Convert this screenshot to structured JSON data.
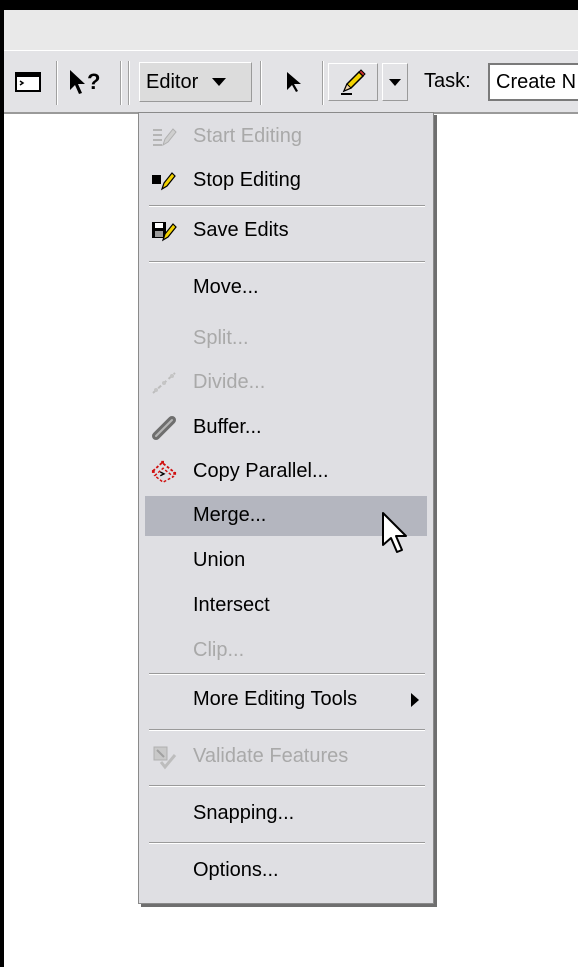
{
  "toolbar": {
    "editor_label": "Editor",
    "task_label": "Task:",
    "task_value": "Create N"
  },
  "menu": {
    "items": [
      {
        "label": "Start Editing",
        "enabled": false,
        "icon": "start-editing-icon"
      },
      {
        "label": "Stop Editing",
        "enabled": true,
        "icon": "stop-editing-icon"
      },
      {
        "label": "Save Edits",
        "enabled": true,
        "icon": "save-edits-icon"
      },
      {
        "label": "Move...",
        "enabled": true,
        "icon": ""
      },
      {
        "label": "Split...",
        "enabled": false,
        "icon": ""
      },
      {
        "label": "Divide...",
        "enabled": false,
        "icon": "divide-icon"
      },
      {
        "label": "Buffer...",
        "enabled": true,
        "icon": "buffer-icon"
      },
      {
        "label": "Copy Parallel...",
        "enabled": true,
        "icon": "copy-parallel-icon"
      },
      {
        "label": "Merge...",
        "enabled": true,
        "highlighted": true,
        "icon": ""
      },
      {
        "label": "Union",
        "enabled": true,
        "icon": ""
      },
      {
        "label": "Intersect",
        "enabled": true,
        "icon": ""
      },
      {
        "label": "Clip...",
        "enabled": false,
        "icon": ""
      },
      {
        "label": "More Editing Tools",
        "enabled": true,
        "submenu": true,
        "icon": ""
      },
      {
        "label": "Validate Features",
        "enabled": false,
        "icon": "validate-features-icon"
      },
      {
        "label": "Snapping...",
        "enabled": true,
        "icon": ""
      },
      {
        "label": "Options...",
        "enabled": true,
        "icon": ""
      }
    ]
  },
  "colors": {
    "menu_bg": "#dfdfe3",
    "highlight": "#b4b6bf",
    "disabled_text": "#a9a9a9"
  }
}
